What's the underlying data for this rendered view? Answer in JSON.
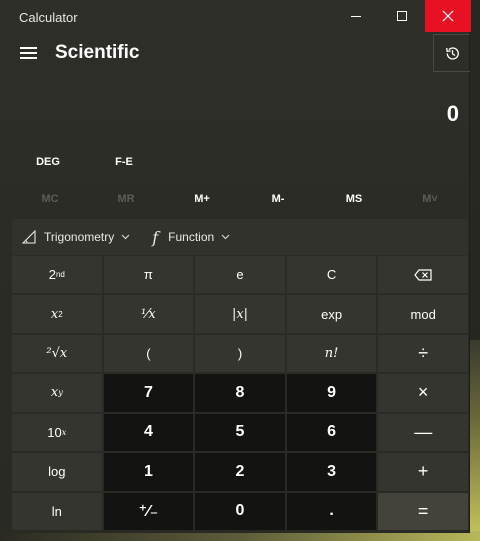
{
  "window": {
    "title": "Calculator"
  },
  "header": {
    "mode": "Scientific"
  },
  "display": {
    "value": "0"
  },
  "toggles": {
    "deg": "DEG",
    "fe": "F-E"
  },
  "memory": [
    {
      "label": "MC",
      "enabled": false
    },
    {
      "label": "MR",
      "enabled": false
    },
    {
      "label": "M+",
      "enabled": true
    },
    {
      "label": "M-",
      "enabled": true
    },
    {
      "label": "MS",
      "enabled": true
    },
    {
      "label": "M˅",
      "enabled": false
    }
  ],
  "function_bar": {
    "trigonometry": "Trigonometry",
    "function": "Function"
  },
  "keys": {
    "second": "2nd",
    "pi": "π",
    "e": "e",
    "clear": "C",
    "backspace": "⌫",
    "square": "x²",
    "reciprocal": "¹⁄x",
    "abs": "|x|",
    "exp": "exp",
    "mod": "mod",
    "sqrt": "²√x",
    "lparen": "(",
    "rparen": ")",
    "factorial": "n!",
    "divide": "÷",
    "pow": "xʸ",
    "seven": "7",
    "eight": "8",
    "nine": "9",
    "multiply": "×",
    "tenpow": "10ˣ",
    "four": "4",
    "five": "5",
    "six": "6",
    "minus": "—",
    "log": "log",
    "one": "1",
    "two": "2",
    "three": "3",
    "plus": "+",
    "ln": "ln",
    "negate": "⁺⁄₋",
    "zero": "0",
    "decimal": ".",
    "equals": "="
  }
}
